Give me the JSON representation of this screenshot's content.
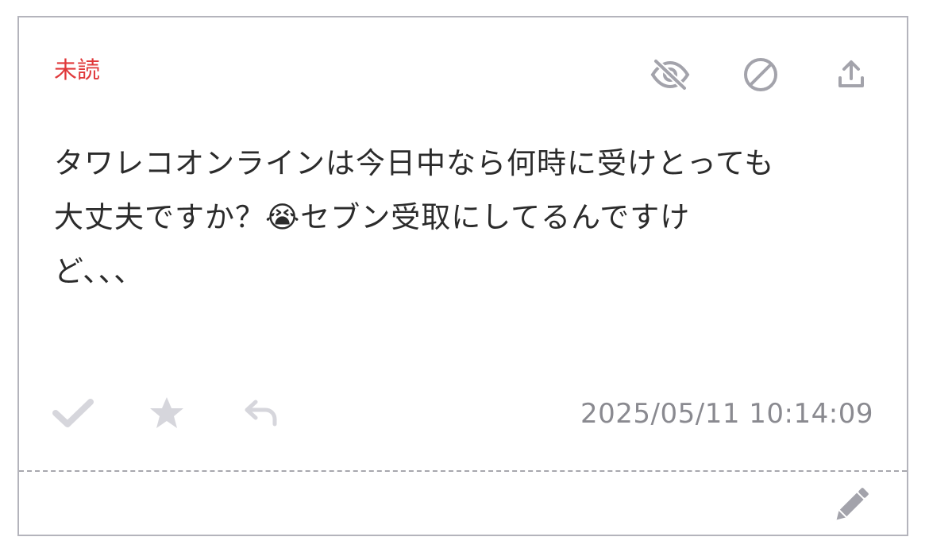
{
  "status": {
    "label": "未読",
    "color": "#e0383a"
  },
  "actions": {
    "hide_icon": "eye-slash-icon",
    "block_icon": "prohibited-icon",
    "share_icon": "share-upload-icon",
    "read_icon": "checkmark-icon",
    "favorite_icon": "star-icon",
    "reply_icon": "reply-icon",
    "edit_icon": "pencil-icon"
  },
  "message": {
    "lines": [
      "タワレコオンラインは今日中なら何時に受けとっても",
      "大丈夫ですか？😭セブン受取にしてるんですけ",
      "ど、、、"
    ]
  },
  "meta": {
    "timestamp": "2025/05/11 10:14:09"
  }
}
